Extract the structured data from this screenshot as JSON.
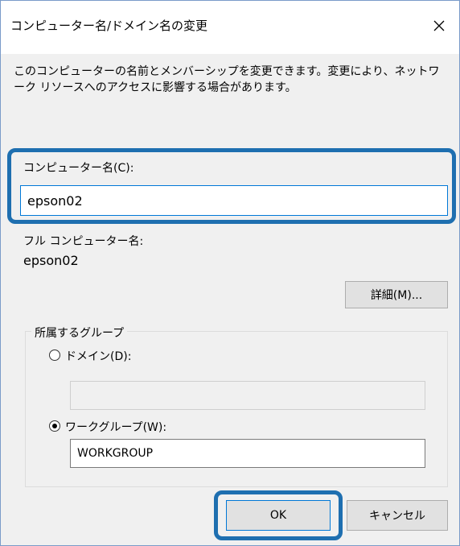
{
  "window": {
    "title": "コンピューター名/ドメイン名の変更",
    "close_glyph": "✕"
  },
  "description": "このコンピューターの名前とメンバーシップを変更できます。変更により、ネットワーク リソースへのアクセスに影響する場合があります。",
  "computer_name": {
    "label": "コンピューター名(C):",
    "value": "epson02"
  },
  "full_computer_name": {
    "label": "フル コンピューター名:",
    "value": "epson02"
  },
  "details_button": "詳細(M)...",
  "member_of": {
    "title": "所属するグループ",
    "domain": {
      "label": "ドメイン(D):",
      "value": "",
      "checked": false
    },
    "workgroup": {
      "label": "ワークグループ(W):",
      "value": "WORKGROUP",
      "checked": true
    }
  },
  "buttons": {
    "ok": "OK",
    "cancel": "キャンセル"
  },
  "colors": {
    "highlight": "#1e6fb0",
    "focus_border": "#0078d7"
  }
}
